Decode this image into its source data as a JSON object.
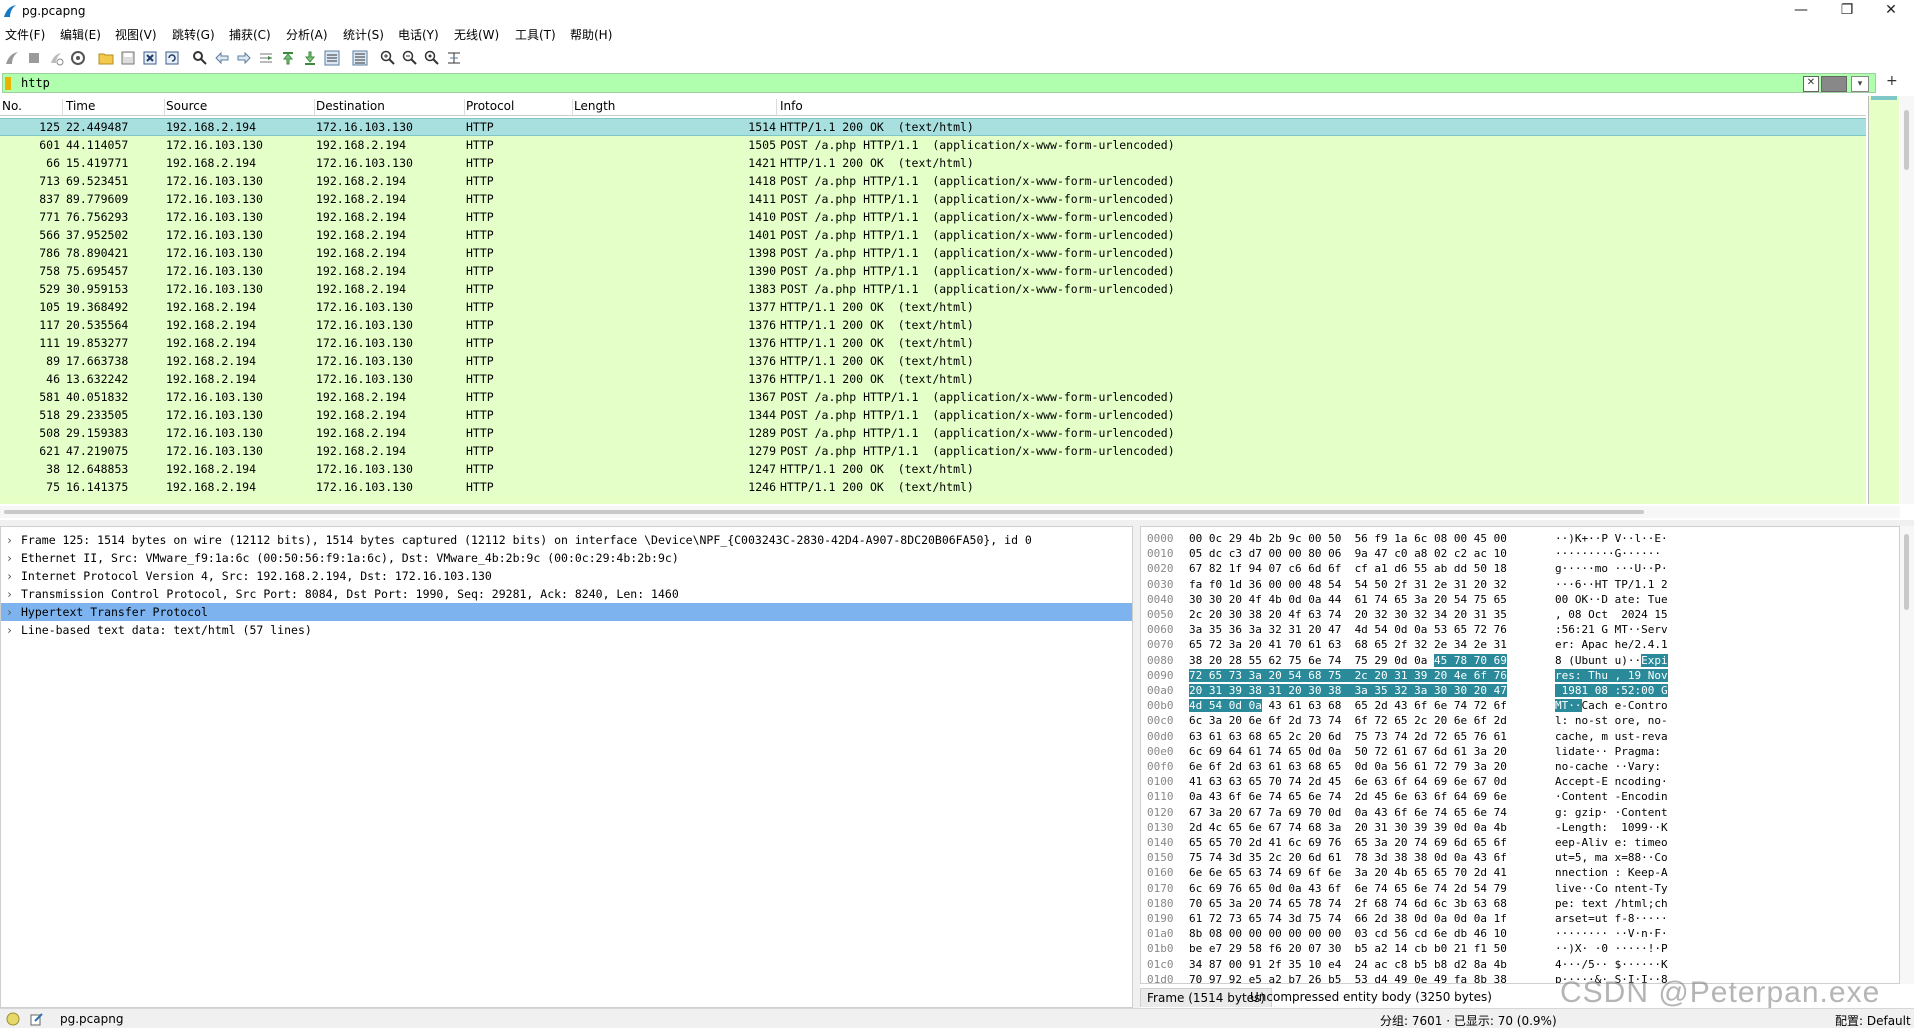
{
  "window": {
    "title": "pg.pcapng"
  },
  "menu": [
    "文件(F)",
    "编辑(E)",
    "视图(V)",
    "跳转(G)",
    "捕获(C)",
    "分析(A)",
    "统计(S)",
    "电话(Y)",
    "无线(W)",
    "工具(T)",
    "帮助(H)"
  ],
  "filter": {
    "value": "http",
    "color": "#afffaf"
  },
  "columns": {
    "no": "No.",
    "time": "Time",
    "source": "Source",
    "destination": "Destination",
    "protocol": "Protocol",
    "length": "Length",
    "info": "Info"
  },
  "packets": [
    {
      "no": "125",
      "time": "22.449487",
      "src": "192.168.2.194",
      "dst": "172.16.103.130",
      "proto": "HTTP",
      "len": "1514",
      "info": "HTTP/1.1 200 OK  (text/html)"
    },
    {
      "no": "601",
      "time": "44.114057",
      "src": "172.16.103.130",
      "dst": "192.168.2.194",
      "proto": "HTTP",
      "len": "1505",
      "info": "POST /a.php HTTP/1.1  (application/x-www-form-urlencoded)"
    },
    {
      "no": "66",
      "time": "15.419771",
      "src": "192.168.2.194",
      "dst": "172.16.103.130",
      "proto": "HTTP",
      "len": "1421",
      "info": "HTTP/1.1 200 OK  (text/html)"
    },
    {
      "no": "713",
      "time": "69.523451",
      "src": "172.16.103.130",
      "dst": "192.168.2.194",
      "proto": "HTTP",
      "len": "1418",
      "info": "POST /a.php HTTP/1.1  (application/x-www-form-urlencoded)"
    },
    {
      "no": "837",
      "time": "89.779609",
      "src": "172.16.103.130",
      "dst": "192.168.2.194",
      "proto": "HTTP",
      "len": "1411",
      "info": "POST /a.php HTTP/1.1  (application/x-www-form-urlencoded)"
    },
    {
      "no": "771",
      "time": "76.756293",
      "src": "172.16.103.130",
      "dst": "192.168.2.194",
      "proto": "HTTP",
      "len": "1410",
      "info": "POST /a.php HTTP/1.1  (application/x-www-form-urlencoded)"
    },
    {
      "no": "566",
      "time": "37.952502",
      "src": "172.16.103.130",
      "dst": "192.168.2.194",
      "proto": "HTTP",
      "len": "1401",
      "info": "POST /a.php HTTP/1.1  (application/x-www-form-urlencoded)"
    },
    {
      "no": "786",
      "time": "78.890421",
      "src": "172.16.103.130",
      "dst": "192.168.2.194",
      "proto": "HTTP",
      "len": "1398",
      "info": "POST /a.php HTTP/1.1  (application/x-www-form-urlencoded)"
    },
    {
      "no": "758",
      "time": "75.695457",
      "src": "172.16.103.130",
      "dst": "192.168.2.194",
      "proto": "HTTP",
      "len": "1390",
      "info": "POST /a.php HTTP/1.1  (application/x-www-form-urlencoded)"
    },
    {
      "no": "529",
      "time": "30.959153",
      "src": "172.16.103.130",
      "dst": "192.168.2.194",
      "proto": "HTTP",
      "len": "1383",
      "info": "POST /a.php HTTP/1.1  (application/x-www-form-urlencoded)"
    },
    {
      "no": "105",
      "time": "19.368492",
      "src": "192.168.2.194",
      "dst": "172.16.103.130",
      "proto": "HTTP",
      "len": "1377",
      "info": "HTTP/1.1 200 OK  (text/html)"
    },
    {
      "no": "117",
      "time": "20.535564",
      "src": "192.168.2.194",
      "dst": "172.16.103.130",
      "proto": "HTTP",
      "len": "1376",
      "info": "HTTP/1.1 200 OK  (text/html)"
    },
    {
      "no": "111",
      "time": "19.853277",
      "src": "192.168.2.194",
      "dst": "172.16.103.130",
      "proto": "HTTP",
      "len": "1376",
      "info": "HTTP/1.1 200 OK  (text/html)"
    },
    {
      "no": "89",
      "time": "17.663738",
      "src": "192.168.2.194",
      "dst": "172.16.103.130",
      "proto": "HTTP",
      "len": "1376",
      "info": "HTTP/1.1 200 OK  (text/html)"
    },
    {
      "no": "46",
      "time": "13.632242",
      "src": "192.168.2.194",
      "dst": "172.16.103.130",
      "proto": "HTTP",
      "len": "1376",
      "info": "HTTP/1.1 200 OK  (text/html)"
    },
    {
      "no": "581",
      "time": "40.051832",
      "src": "172.16.103.130",
      "dst": "192.168.2.194",
      "proto": "HTTP",
      "len": "1367",
      "info": "POST /a.php HTTP/1.1  (application/x-www-form-urlencoded)"
    },
    {
      "no": "518",
      "time": "29.233505",
      "src": "172.16.103.130",
      "dst": "192.168.2.194",
      "proto": "HTTP",
      "len": "1344",
      "info": "POST /a.php HTTP/1.1  (application/x-www-form-urlencoded)"
    },
    {
      "no": "508",
      "time": "29.159383",
      "src": "172.16.103.130",
      "dst": "192.168.2.194",
      "proto": "HTTP",
      "len": "1289",
      "info": "POST /a.php HTTP/1.1  (application/x-www-form-urlencoded)"
    },
    {
      "no": "621",
      "time": "47.219075",
      "src": "172.16.103.130",
      "dst": "192.168.2.194",
      "proto": "HTTP",
      "len": "1279",
      "info": "POST /a.php HTTP/1.1  (application/x-www-form-urlencoded)"
    },
    {
      "no": "38",
      "time": "12.648853",
      "src": "192.168.2.194",
      "dst": "172.16.103.130",
      "proto": "HTTP",
      "len": "1247",
      "info": "HTTP/1.1 200 OK  (text/html)"
    },
    {
      "no": "75",
      "time": "16.141375",
      "src": "192.168.2.194",
      "dst": "172.16.103.130",
      "proto": "HTTP",
      "len": "1246",
      "info": "HTTP/1.1 200 OK  (text/html)"
    }
  ],
  "details": [
    "Frame 125: 1514 bytes on wire (12112 bits), 1514 bytes captured (12112 bits) on interface \\Device\\NPF_{C003243C-2830-42D4-A907-8DC20B06FA50}, id 0",
    "Ethernet II, Src: VMware_f9:1a:6c (00:50:56:f9:1a:6c), Dst: VMware_4b:2b:9c (00:0c:29:4b:2b:9c)",
    "Internet Protocol Version 4, Src: 192.168.2.194, Dst: 172.16.103.130",
    "Transmission Control Protocol, Src Port: 8084, Dst Port: 1990, Seq: 29281, Ack: 8240, Len: 1460",
    "Hypertext Transfer Protocol",
    "Line-based text data: text/html (57 lines)"
  ],
  "bytes": [
    {
      "off": "0000",
      "hex": "00 0c 29 4b 2b 9c 00 50  56 f9 1a 6c 08 00 45 00",
      "asc": "··)K+··P V··l··E·"
    },
    {
      "off": "0010",
      "hex": "05 dc c3 d7 00 00 80 06  9a 47 c0 a8 02 c2 ac 10",
      "asc": "·········G······"
    },
    {
      "off": "0020",
      "hex": "67 82 1f 94 07 c6 6d 6f  cf a1 d6 55 ab dd 50 18",
      "asc": "g·····mo ···U··P·"
    },
    {
      "off": "0030",
      "hex": "fa f0 1d 36 00 00 48 54  54 50 2f 31 2e 31 20 32",
      "asc": "···6··HT TP/1.1 2"
    },
    {
      "off": "0040",
      "hex": "30 30 20 4f 4b 0d 0a 44  61 74 65 3a 20 54 75 65",
      "asc": "00 OK··D ate: Tue"
    },
    {
      "off": "0050",
      "hex": "2c 20 30 38 20 4f 63 74  20 32 30 32 34 20 31 35",
      "asc": ", 08 Oct  2024 15"
    },
    {
      "off": "0060",
      "hex": "3a 35 36 3a 32 31 20 47  4d 54 0d 0a 53 65 72 76",
      "asc": ":56:21 G MT··Serv"
    },
    {
      "off": "0070",
      "hex": "65 72 3a 20 41 70 61 63  68 65 2f 32 2e 34 2e 31",
      "asc": "er: Apac he/2.4.1"
    },
    {
      "off": "0080",
      "hex": "38 20 28 55 62 75 6e 74  75 29 0d 0a ",
      "hexhl": "45 78 70 69",
      "asc": "8 (Ubunt u)··",
      "aschl": "Expi"
    },
    {
      "off": "0090",
      "hexhlfull": "72 65 73 3a 20 54 68 75  2c 20 31 39 20 4e 6f 76",
      "aschlfull": "res: Thu , 19 Nov"
    },
    {
      "off": "00a0",
      "hexhlfull": "20 31 39 38 31 20 30 38  3a 35 32 3a 30 30 20 47",
      "aschlfull": " 1981 08 :52:00 G"
    },
    {
      "off": "00b0",
      "hexhl": "4d 54 0d 0a",
      "hex": " 43 61 63 68  65 2d 43 6f 6e 74 72 6f",
      "aschl": "MT··",
      "asc": "Cach e-Contro"
    },
    {
      "off": "00c0",
      "hex": "6c 3a 20 6e 6f 2d 73 74  6f 72 65 2c 20 6e 6f 2d",
      "asc": "l: no-st ore, no-"
    },
    {
      "off": "00d0",
      "hex": "63 61 63 68 65 2c 20 6d  75 73 74 2d 72 65 76 61",
      "asc": "cache, m ust-reva"
    },
    {
      "off": "00e0",
      "hex": "6c 69 64 61 74 65 0d 0a  50 72 61 67 6d 61 3a 20",
      "asc": "lidate·· Pragma: "
    },
    {
      "off": "00f0",
      "hex": "6e 6f 2d 63 61 63 68 65  0d 0a 56 61 72 79 3a 20",
      "asc": "no-cache ··Vary: "
    },
    {
      "off": "0100",
      "hex": "41 63 63 65 70 74 2d 45  6e 63 6f 64 69 6e 67 0d",
      "asc": "Accept-E ncoding·"
    },
    {
      "off": "0110",
      "hex": "0a 43 6f 6e 74 65 6e 74  2d 45 6e 63 6f 64 69 6e",
      "asc": "·Content -Encodin"
    },
    {
      "off": "0120",
      "hex": "67 3a 20 67 7a 69 70 0d  0a 43 6f 6e 74 65 6e 74",
      "asc": "g: gzip· ·Content"
    },
    {
      "off": "0130",
      "hex": "2d 4c 65 6e 67 74 68 3a  20 31 30 39 39 0d 0a 4b",
      "asc": "-Length:  1099··K"
    },
    {
      "off": "0140",
      "hex": "65 65 70 2d 41 6c 69 76  65 3a 20 74 69 6d 65 6f",
      "asc": "eep-Aliv e: timeo"
    },
    {
      "off": "0150",
      "hex": "75 74 3d 35 2c 20 6d 61  78 3d 38 38 0d 0a 43 6f",
      "asc": "ut=5, ma x=88··Co"
    },
    {
      "off": "0160",
      "hex": "6e 6e 65 63 74 69 6f 6e  3a 20 4b 65 65 70 2d 41",
      "asc": "nnection : Keep-A"
    },
    {
      "off": "0170",
      "hex": "6c 69 76 65 0d 0a 43 6f  6e 74 65 6e 74 2d 54 79",
      "asc": "live··Co ntent-Ty"
    },
    {
      "off": "0180",
      "hex": "70 65 3a 20 74 65 78 74  2f 68 74 6d 6c 3b 63 68",
      "asc": "pe: text /html;ch"
    },
    {
      "off": "0190",
      "hex": "61 72 73 65 74 3d 75 74  66 2d 38 0d 0a 0d 0a 1f",
      "asc": "arset=ut f-8·····"
    },
    {
      "off": "01a0",
      "hex": "8b 08 00 00 00 00 00 00  03 cd 56 cd 6e db 46 10",
      "asc": "········ ··V·n·F·"
    },
    {
      "off": "01b0",
      "hex": "be e7 29 58 f6 20 07 30  b5 a2 14 cb b0 21 f1 50",
      "asc": "··)X· ·0 ·····!·P"
    },
    {
      "off": "01c0",
      "hex": "34 87 00 91 2f 35 10 e4  24 ac c8 b5 b8 d2 8a 4b",
      "asc": "4···/5·· $······K"
    },
    {
      "off": "01d0",
      "hex": "70 97 92 e5 a2 b7 26 b5  53 d4 49 0e 49 fa 8b 38",
      "asc": "p·····&· S·I·I··8"
    }
  ],
  "byte_tabs": [
    "Frame (1514 bytes)",
    "Uncompressed entity body (3250 bytes)"
  ],
  "status": {
    "file": "pg.pcapng",
    "stats": "分组: 7601 · 已显示: 70 (0.9%)",
    "profile": "配置: Default"
  },
  "watermark": "CSDN @Peterpan.exe"
}
